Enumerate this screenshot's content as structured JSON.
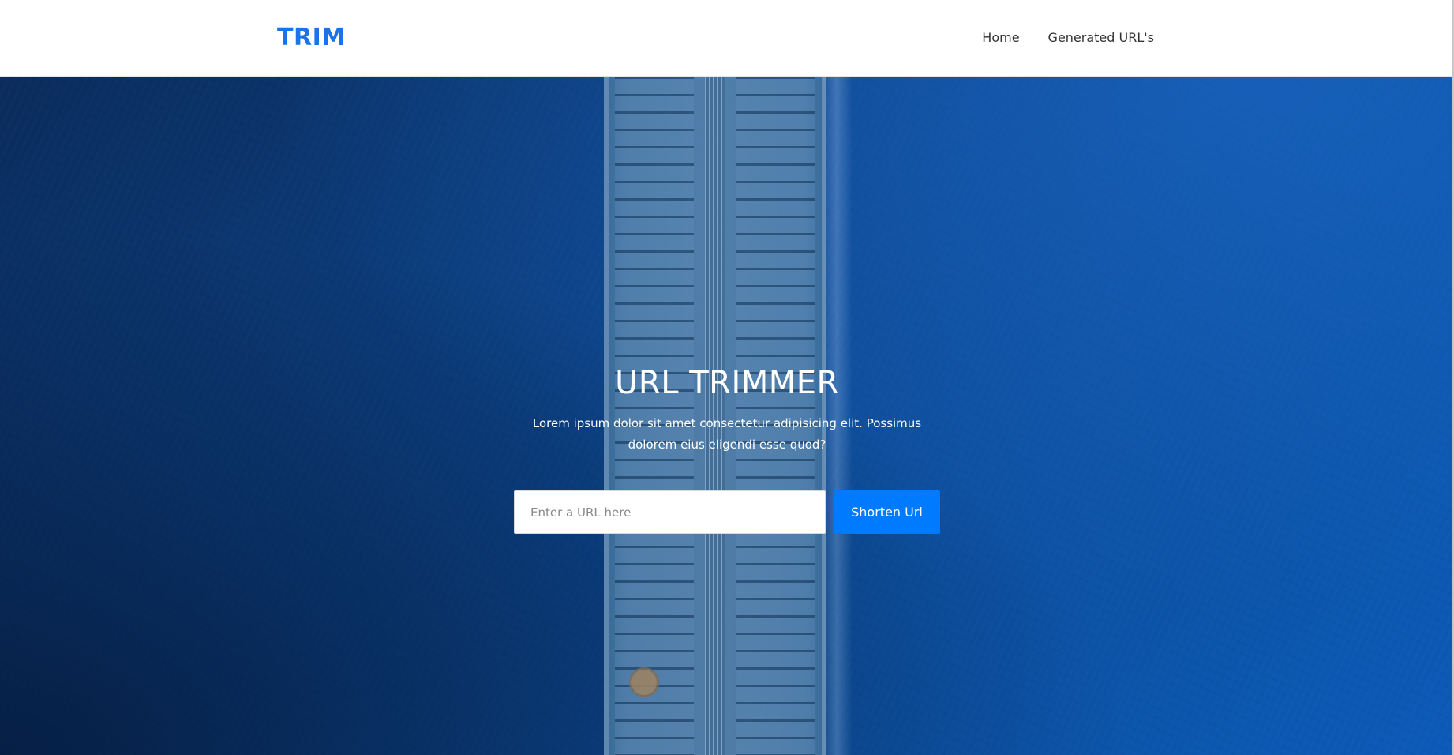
{
  "navbar": {
    "brand": "TRIM",
    "links": [
      {
        "label": "Home"
      },
      {
        "label": "Generated URL's"
      }
    ]
  },
  "hero": {
    "title": "URL TRIMMER",
    "subtitle": "Lorem ipsum dolor sit amet consectetur adipisicing elit. Possimus dolorem eius eligendi esse quod?",
    "form": {
      "input_placeholder": "Enter a URL here",
      "input_value": "",
      "button_label": "Shorten Url"
    }
  },
  "colors": {
    "brand": "#1a73e8",
    "button": "#007bff",
    "hero_dark": "#0b2c5c",
    "hero_light": "#0c5bb8"
  }
}
